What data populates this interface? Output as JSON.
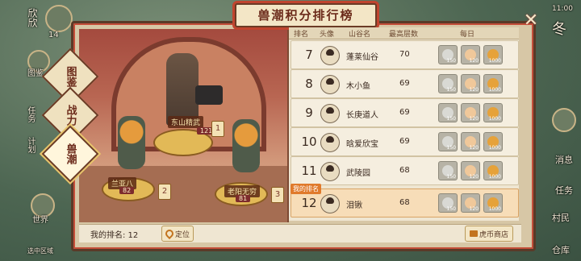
{
  "title": "兽潮积分排行榜",
  "left_hud": {
    "labels": [
      "欣欣",
      "14",
      "图鉴",
      "任务",
      "计划",
      "世界",
      "选中区域"
    ],
    "top_right": "11:00"
  },
  "right_hud": [
    "冬",
    "消息",
    "任务",
    "村民",
    "仓库"
  ],
  "tabs": [
    {
      "label": "图鉴",
      "active": false
    },
    {
      "label": "战力",
      "active": false
    },
    {
      "label": "兽潮",
      "active": true
    }
  ],
  "heroes": [
    {
      "name": "东山精武",
      "level": "121",
      "place": "1"
    },
    {
      "name": "兰亚八",
      "level": "82",
      "place": "2"
    },
    {
      "name": "老阳无穷",
      "level": "81",
      "place": "3"
    }
  ],
  "table": {
    "headers": [
      "排名",
      "头像",
      "山谷名",
      "最高层数",
      "每日"
    ],
    "rows": [
      {
        "rank": "7",
        "name": "蓬莱仙谷",
        "floor": "70",
        "me": false,
        "rewards": [
          "150",
          "120",
          "1000"
        ]
      },
      {
        "rank": "8",
        "name": "木小鱼",
        "floor": "69",
        "me": false,
        "rewards": [
          "150",
          "120",
          "1000"
        ]
      },
      {
        "rank": "9",
        "name": "长庚道人",
        "floor": "69",
        "me": false,
        "rewards": [
          "150",
          "120",
          "1000"
        ]
      },
      {
        "rank": "10",
        "name": "晗爱欣宝",
        "floor": "69",
        "me": false,
        "rewards": [
          "150",
          "120",
          "1000"
        ]
      },
      {
        "rank": "11",
        "name": "武陵园",
        "floor": "68",
        "me": false,
        "rewards": [
          "150",
          "120",
          "1000"
        ]
      },
      {
        "rank": "12",
        "name": "泪锹",
        "floor": "68",
        "me": true,
        "rewards": [
          "150",
          "120",
          "1000"
        ]
      }
    ],
    "my_rank_tag": "我的排名"
  },
  "footer": {
    "my_rank": "我的排名: 12",
    "locate": "定位",
    "shop": "虎币商店"
  },
  "colors": {
    "frame": "#5a3a28",
    "accent": "#c0452f",
    "parchment": "#efe6d2"
  }
}
